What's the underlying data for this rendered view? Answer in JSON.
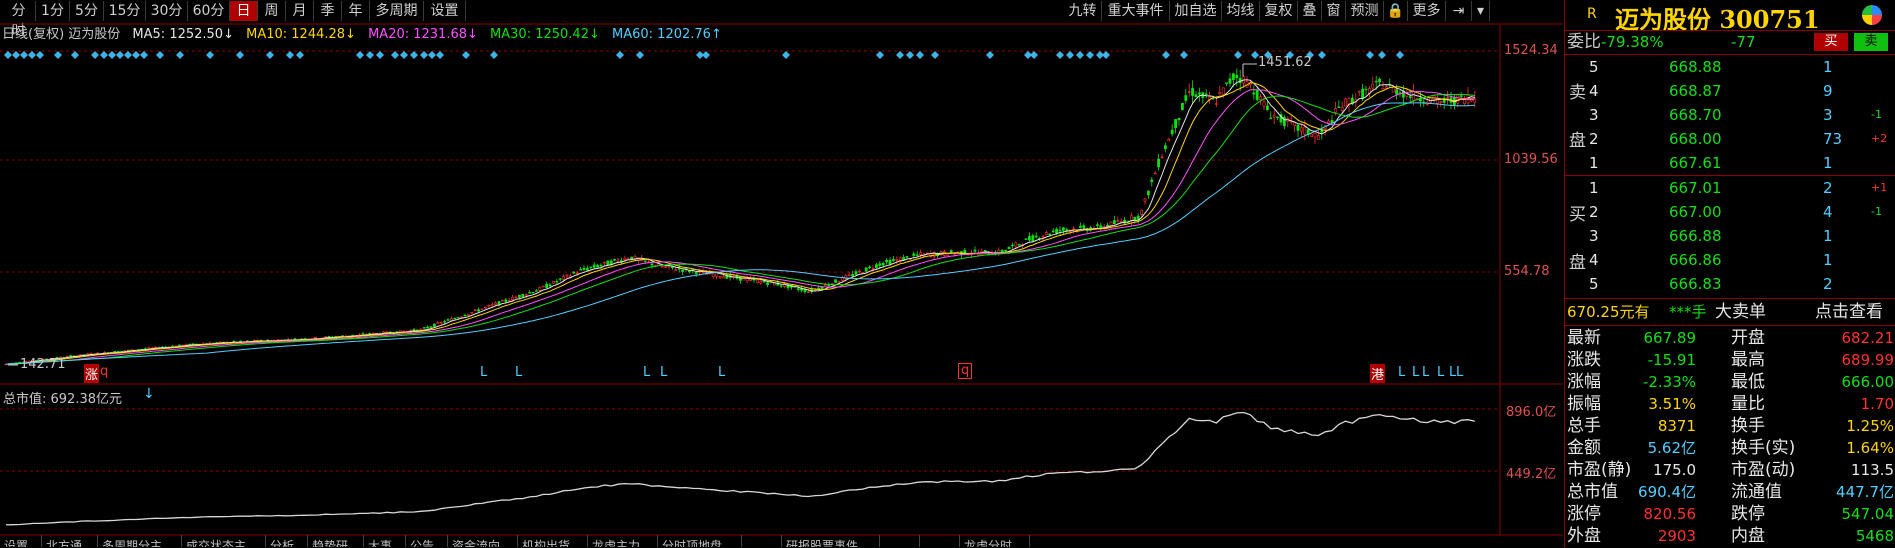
{
  "toolbar": {
    "periods": [
      "分时",
      "1分",
      "5分",
      "15分",
      "30分",
      "60分",
      "日",
      "周",
      "月",
      "季",
      "年",
      "多周期",
      "设置"
    ],
    "active_period": "日",
    "tools": [
      "九转",
      "重大事件",
      "加自选",
      "均线",
      "复权",
      "叠",
      "窗",
      "预测",
      "🔒",
      "更多",
      "⇥"
    ]
  },
  "ma_line": {
    "prefix": "日线(复权)  迈为股份",
    "ma5": "MA5: 1252.50↓",
    "ma10": "MA10: 1244.28↓",
    "ma20": "MA20: 1231.68↓",
    "ma30": "MA30: 1250.42↓",
    "ma60": "MA60: 1202.76↑"
  },
  "price_axis": [
    "1524.34",
    "1039.56",
    "554.78"
  ],
  "annotations": {
    "high": "1451.62",
    "low": "142.71"
  },
  "markers": {
    "zhang": "涨",
    "q": "q",
    "gang": "港",
    "L": "L"
  },
  "mktcap": {
    "label": "总市值: 692.38亿元",
    "axis_top": "896.0亿",
    "axis_mid": "449.2亿"
  },
  "bottom_tabs": [
    "设置",
    "北方通",
    "多周期分主",
    "成交状态主",
    "分析",
    "趋势研",
    "大事",
    "公告",
    "资金流向",
    "机构出货",
    "龙虎主力",
    "分时顶地盘",
    "",
    "研报股票事件",
    "",
    "",
    "龙虎分时"
  ],
  "quote": {
    "tag": "R",
    "title": "迈为股份 300751",
    "weibi_label": "委比",
    "weibi_pct": "-79.38%",
    "weibi_diff": "-77",
    "buy_btn": "买",
    "sell_btn": "卖",
    "sell_label": [
      "卖",
      "盘"
    ],
    "buy_label": [
      "买",
      "盘"
    ],
    "asks": [
      {
        "lvl": "5",
        "price": "668.88",
        "vol": "1",
        "chg": ""
      },
      {
        "lvl": "4",
        "price": "668.87",
        "vol": "9",
        "chg": ""
      },
      {
        "lvl": "3",
        "price": "668.70",
        "vol": "3",
        "chg": "-1"
      },
      {
        "lvl": "2",
        "price": "668.00",
        "vol": "73",
        "chg": "+2"
      },
      {
        "lvl": "1",
        "price": "667.61",
        "vol": "1",
        "chg": ""
      }
    ],
    "bids": [
      {
        "lvl": "1",
        "price": "667.01",
        "vol": "2",
        "chg": "+1"
      },
      {
        "lvl": "2",
        "price": "667.00",
        "vol": "4",
        "chg": "-1"
      },
      {
        "lvl": "3",
        "price": "666.88",
        "vol": "1",
        "chg": ""
      },
      {
        "lvl": "4",
        "price": "666.86",
        "vol": "1",
        "chg": ""
      },
      {
        "lvl": "5",
        "price": "666.83",
        "vol": "2",
        "chg": ""
      }
    ],
    "big_order": {
      "price": "670.25元有",
      "hands": "***手",
      "type": "大卖单",
      "action": "点击查看"
    },
    "stats": [
      {
        "k1": "最新",
        "v1": "667.89",
        "c1": "green",
        "k2": "开盘",
        "v2": "682.21",
        "c2": "red"
      },
      {
        "k1": "涨跌",
        "v1": "-15.91",
        "c1": "green",
        "k2": "最高",
        "v2": "689.99",
        "c2": "red"
      },
      {
        "k1": "涨幅",
        "v1": "-2.33%",
        "c1": "green",
        "k2": "最低",
        "v2": "666.00",
        "c2": "green"
      },
      {
        "k1": "振幅",
        "v1": "3.51%",
        "c1": "yellow",
        "k2": "量比",
        "v2": "1.70",
        "c2": "red"
      },
      {
        "k1": "总手",
        "v1": "8371",
        "c1": "yellow",
        "k2": "换手",
        "v2": "1.25%",
        "c2": "yellow"
      },
      {
        "k1": "金额",
        "v1": "5.62亿",
        "c1": "cyan",
        "k2": "换手(实)",
        "v2": "1.64%",
        "c2": "yellow"
      },
      {
        "k1": "市盈(静)",
        "v1": "175.0",
        "c1": "white",
        "k2": "市盈(动)",
        "v2": "113.5",
        "c2": "white"
      },
      {
        "k1": "总市值",
        "v1": "690.4亿",
        "c1": "cyan",
        "k2": "流通值",
        "v2": "447.7亿",
        "c2": "cyan"
      },
      {
        "k1": "涨停",
        "v1": "820.56",
        "c1": "red",
        "k2": "跌停",
        "v2": "547.04",
        "c2": "green"
      },
      {
        "k1": "外盘",
        "v1": "2903",
        "c1": "red",
        "k2": "内盘",
        "v2": "5468",
        "c2": "green"
      }
    ]
  },
  "colors": {
    "up": "#ff3030",
    "down": "#10e010",
    "ma5": "#e6e6e6",
    "ma10": "#ffd500",
    "ma20": "#ff50ff",
    "ma30": "#10e010",
    "ma60": "#4fd0ff",
    "grid": "#8a0000"
  }
}
